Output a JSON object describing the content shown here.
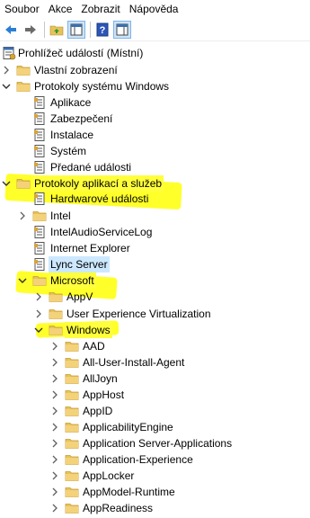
{
  "menu": [
    "Soubor",
    "Akce",
    "Zobrazit",
    "Nápověda"
  ],
  "toolbar": {
    "buttons": [
      "back-arrow-icon",
      "forward-arrow-icon",
      "up-folder-icon",
      "show-hide-console-tree-icon",
      "help-icon",
      "show-hide-action-pane-icon"
    ]
  },
  "tree": {
    "items": [
      {
        "label": "Prohlížeč událostí (Místní)",
        "icon": "event-viewer-icon",
        "expanded": true,
        "hasChevron": false
      },
      {
        "label": "Vlastní zobrazení",
        "icon": "folder-icon",
        "expanded": false,
        "hasChevron": true
      },
      {
        "label": "Protokoly systému Windows",
        "icon": "folder-icon",
        "expanded": true,
        "hasChevron": true
      },
      {
        "label": "Aplikace",
        "icon": "log-icon"
      },
      {
        "label": "Zabezpečení",
        "icon": "log-icon"
      },
      {
        "label": "Instalace",
        "icon": "log-icon"
      },
      {
        "label": "Systém",
        "icon": "log-icon"
      },
      {
        "label": "Předané události",
        "icon": "log-icon"
      },
      {
        "label": "Protokoly aplikací a služeb",
        "icon": "folder-icon",
        "expanded": true,
        "hasChevron": true
      },
      {
        "label": "Hardwarové události",
        "icon": "log-icon"
      },
      {
        "label": "Intel",
        "icon": "folder-icon",
        "expanded": false,
        "hasChevron": true
      },
      {
        "label": "IntelAudioServiceLog",
        "icon": "log-icon"
      },
      {
        "label": "Internet Explorer",
        "icon": "log-icon"
      },
      {
        "label": "Lync Server",
        "icon": "log-icon",
        "selected": true
      },
      {
        "label": "Microsoft",
        "icon": "folder-icon",
        "expanded": true,
        "hasChevron": true
      },
      {
        "label": "AppV",
        "icon": "folder-icon",
        "expanded": false,
        "hasChevron": true
      },
      {
        "label": "User Experience Virtualization",
        "icon": "folder-icon",
        "expanded": false,
        "hasChevron": true
      },
      {
        "label": "Windows",
        "icon": "folder-icon",
        "expanded": true,
        "hasChevron": true
      },
      {
        "label": "AAD",
        "icon": "folder-icon",
        "expanded": false,
        "hasChevron": true
      },
      {
        "label": "All-User-Install-Agent",
        "icon": "folder-icon",
        "expanded": false,
        "hasChevron": true
      },
      {
        "label": "AllJoyn",
        "icon": "folder-icon",
        "expanded": false,
        "hasChevron": true
      },
      {
        "label": "AppHost",
        "icon": "folder-icon",
        "expanded": false,
        "hasChevron": true
      },
      {
        "label": "AppID",
        "icon": "folder-icon",
        "expanded": false,
        "hasChevron": true
      },
      {
        "label": "ApplicabilityEngine",
        "icon": "folder-icon",
        "expanded": false,
        "hasChevron": true
      },
      {
        "label": "Application Server-Applications",
        "icon": "folder-icon",
        "expanded": false,
        "hasChevron": true
      },
      {
        "label": "Application-Experience",
        "icon": "folder-icon",
        "expanded": false,
        "hasChevron": true
      },
      {
        "label": "AppLocker",
        "icon": "folder-icon",
        "expanded": false,
        "hasChevron": true
      },
      {
        "label": "AppModel-Runtime",
        "icon": "folder-icon",
        "expanded": false,
        "hasChevron": true
      },
      {
        "label": "AppReadiness",
        "icon": "folder-icon",
        "expanded": false,
        "hasChevron": true
      }
    ]
  },
  "colors": {
    "highlight": "#ffff3c",
    "selection": "#cce8ff",
    "folder": "#e8c25a",
    "chevron": "#606060"
  }
}
